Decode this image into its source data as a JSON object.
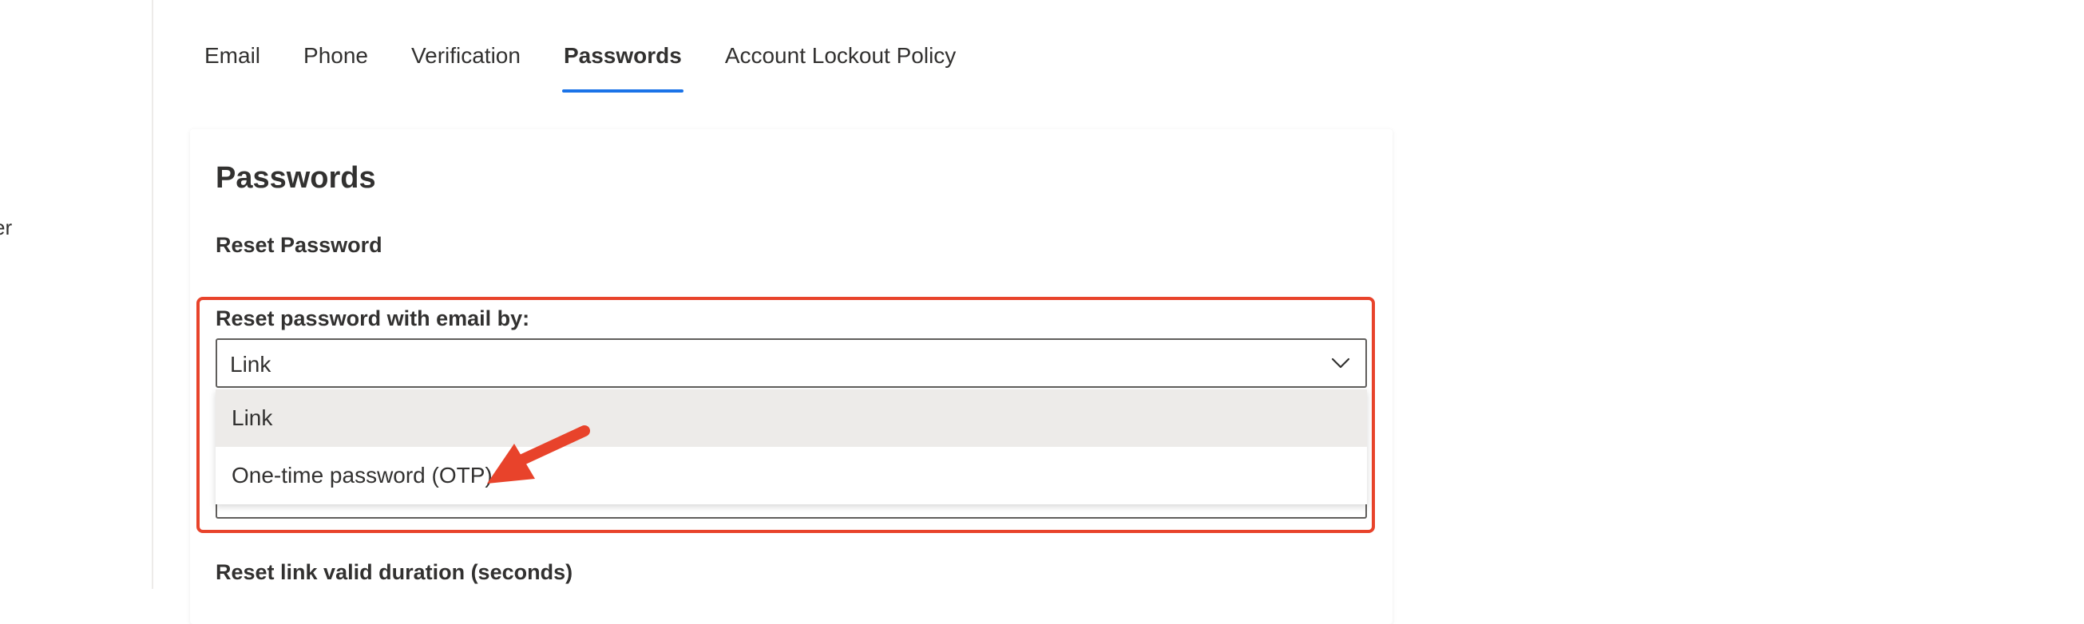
{
  "left_nav": {
    "fragment": "er"
  },
  "tabs": [
    {
      "label": "Email",
      "active": false
    },
    {
      "label": "Phone",
      "active": false
    },
    {
      "label": "Verification",
      "active": false
    },
    {
      "label": "Passwords",
      "active": true
    },
    {
      "label": "Account Lockout Policy",
      "active": false
    }
  ],
  "card": {
    "title": "Passwords",
    "section_title": "Reset Password",
    "reset_by": {
      "label": "Reset password with email by:",
      "value": "Link",
      "options": [
        {
          "label": "Link",
          "selected": true
        },
        {
          "label": "One-time password (OTP)",
          "selected": false
        }
      ]
    },
    "link_duration_label": "Reset link valid duration (seconds)"
  },
  "colors": {
    "accent": "#1a73e8",
    "highlight": "#e8432b",
    "text": "#323130",
    "selected_option_bg": "#edebe9"
  },
  "icons": {
    "chevron": "chevron-down-icon",
    "arrow": "annotation-arrow-icon"
  }
}
